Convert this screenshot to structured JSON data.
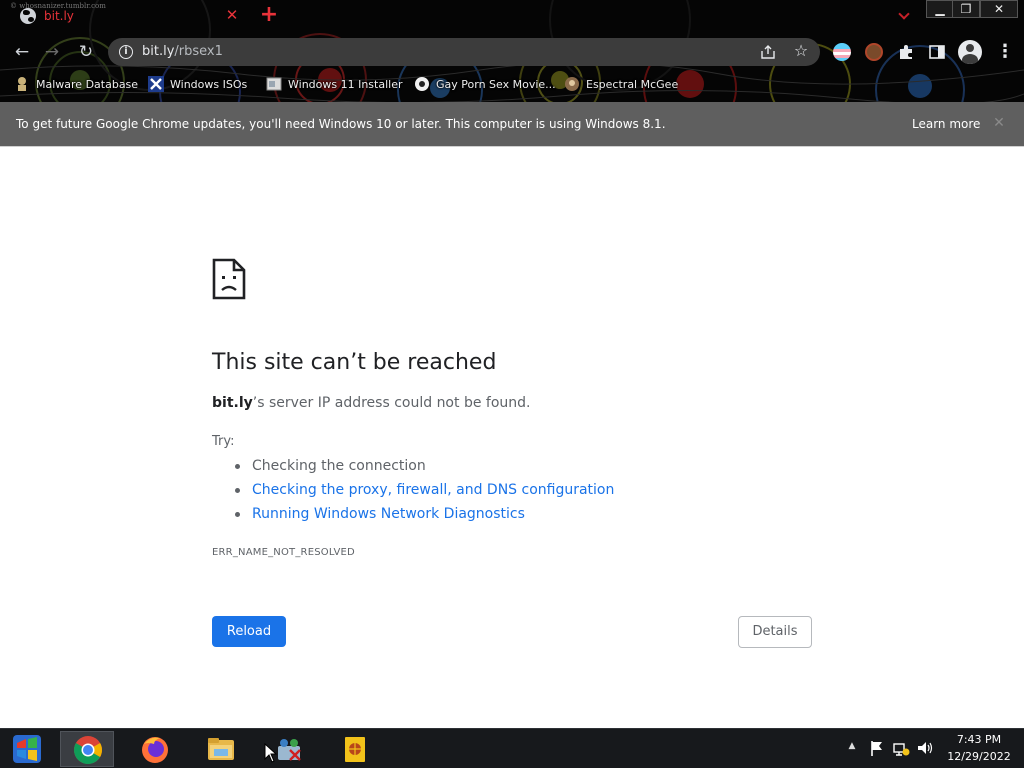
{
  "tab": {
    "title": "bit.ly",
    "watermark": "© whosnanizer.tumblr.com"
  },
  "omnibox": {
    "url_host": "bit.ly",
    "url_path": "/rbsex1"
  },
  "bookmarks": [
    {
      "label": "Malware Database",
      "icon": "malware-db-icon"
    },
    {
      "label": "Windows ISOs",
      "icon": "windows-isos-icon"
    },
    {
      "label": "Windows 11 Installer",
      "icon": "installer-icon"
    },
    {
      "label": "Gay Porn Sex Movie...",
      "icon": "bookmark-site-icon"
    },
    {
      "label": "Espectral McGee",
      "icon": "espectral-icon"
    }
  ],
  "infobar": {
    "message": "To get future Google Chrome updates, you'll need Windows 10 or later. This computer is using Windows 8.1.",
    "learn_more": "Learn more"
  },
  "error_page": {
    "title": "This site can’t be reached",
    "summary_host": "bit.ly",
    "summary_rest": "’s server IP address could not be found.",
    "try_label": "Try:",
    "suggestions": [
      "Checking the connection",
      "Checking the proxy, firewall, and DNS configuration",
      "Running Windows Network Diagnostics"
    ],
    "error_code": "ERR_NAME_NOT_RESOLVED",
    "reload_label": "Reload",
    "details_label": "Details"
  },
  "taskbar": {
    "apps": [
      "start-orb-icon",
      "chrome-icon",
      "firefox-icon",
      "file-explorer-icon",
      "network-users-icon",
      "book-app-icon"
    ],
    "clock_time": "7:43 PM",
    "clock_date": "12/29/2022"
  },
  "colors": {
    "accent_blue": "#1a73e8",
    "tab_red": "#e8333a",
    "infobar_bg": "#5f5f5f",
    "chrome_bg": "#050505"
  }
}
